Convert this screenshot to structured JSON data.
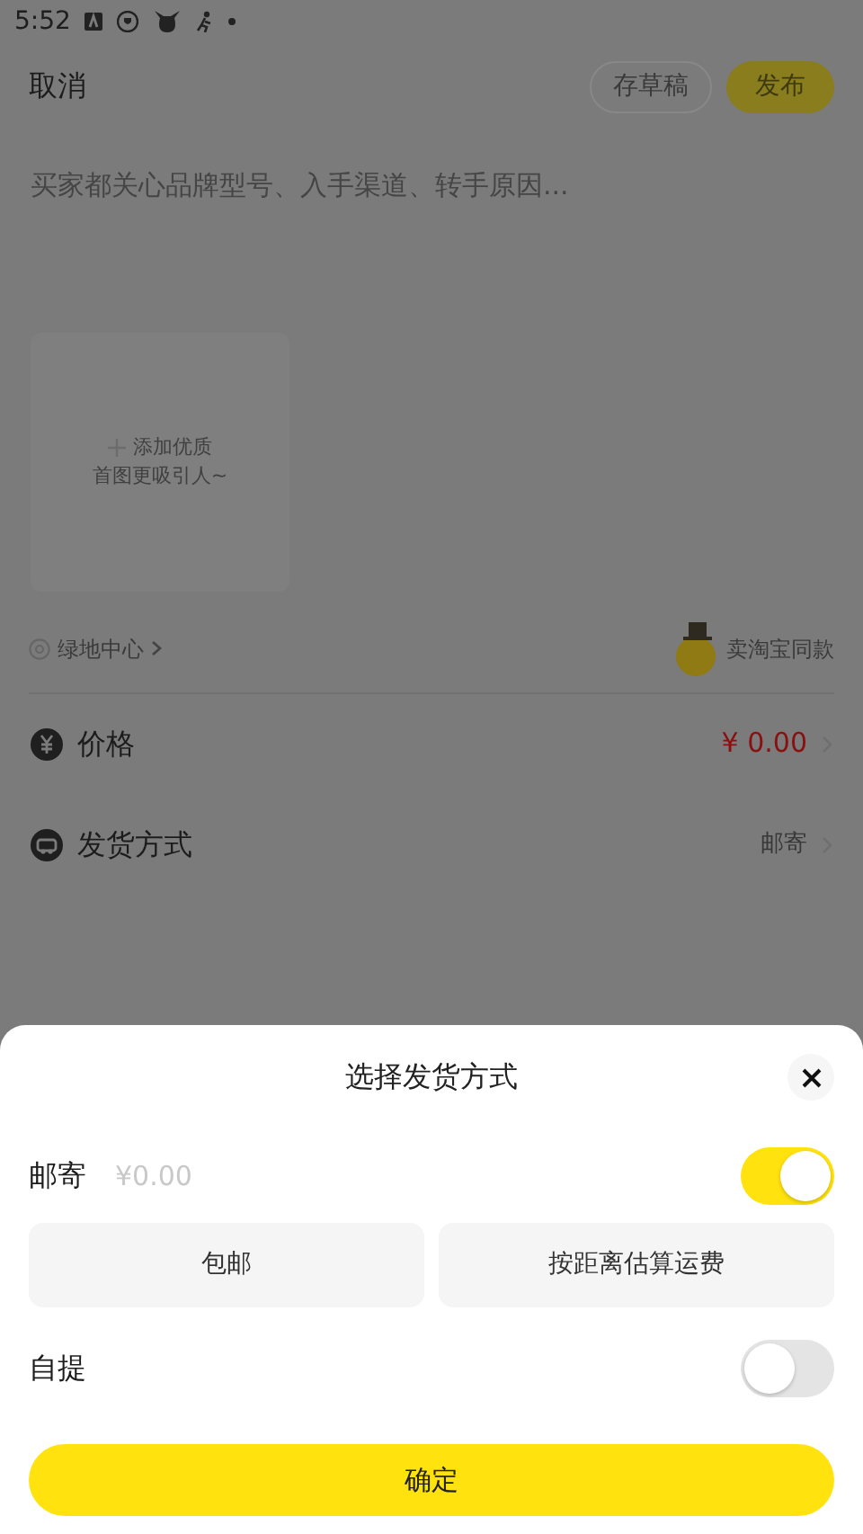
{
  "status_bar": {
    "time": "5:52"
  },
  "header": {
    "cancel": "取消",
    "draft": "存草稿",
    "publish": "发布"
  },
  "description": {
    "placeholder": "买家都关心品牌型号、入手渠道、转手原因..."
  },
  "photo_upload": {
    "line1": "添加优质",
    "line2": "首图更吸引人~"
  },
  "location": {
    "label": "绿地中心"
  },
  "same_style": {
    "label": "卖淘宝同款"
  },
  "rows": [
    {
      "kind": "price",
      "label": "价格",
      "value": "¥ 0.00"
    },
    {
      "kind": "shipping",
      "label": "发货方式",
      "value": "邮寄"
    }
  ],
  "sheet": {
    "title": "选择发货方式",
    "options": [
      {
        "label": "邮寄",
        "price": "¥0.00",
        "on": true
      },
      {
        "label": "自提",
        "on": false
      }
    ],
    "fee_buttons": [
      "包邮",
      "按距离估算运费"
    ],
    "confirm": "确定"
  }
}
